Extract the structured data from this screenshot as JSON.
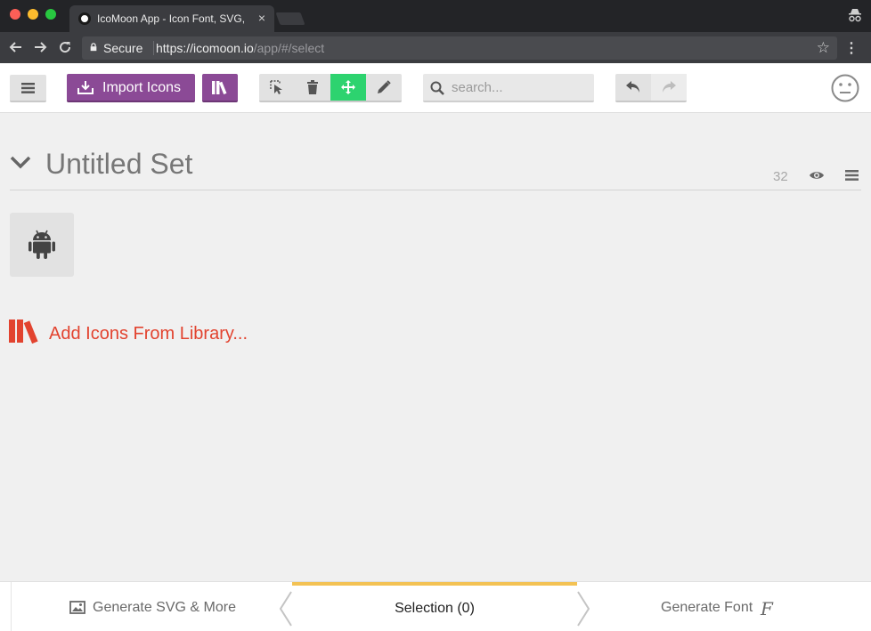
{
  "browser": {
    "tab_title": "IcoMoon App - Icon Font, SVG,",
    "tab_close": "×",
    "secure_label": "Secure",
    "url_host": "https://icomoon.io",
    "url_path": "/app/#/select"
  },
  "toolbar": {
    "import_label": "Import Icons",
    "search_placeholder": "search..."
  },
  "set": {
    "title": "Untitled Set",
    "icon_count": "32",
    "add_library_label": "Add Icons From Library..."
  },
  "bottom": {
    "generate_svg_label": "Generate SVG & More",
    "selection_label": "Selection (0)",
    "generate_font_label": "Generate Font",
    "font_glyph": "F"
  },
  "colors": {
    "accent_purple": "#8b4a96",
    "active_green": "#2dd36f",
    "library_red": "#e2432f",
    "selection_yellow": "#f3c254"
  }
}
